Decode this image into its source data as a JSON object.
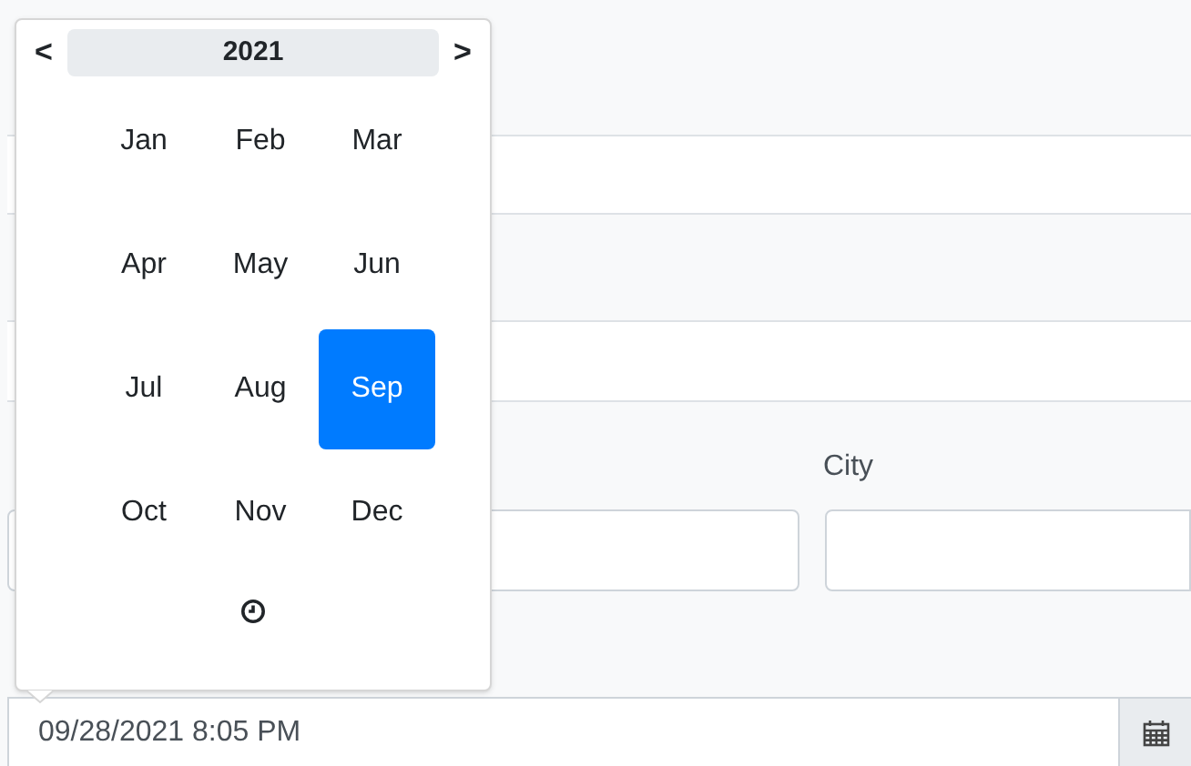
{
  "form": {
    "city_label": "City",
    "date_value": "09/28/2021 8:05 PM"
  },
  "date_picker": {
    "year": "2021",
    "prev": "<",
    "next": ">",
    "months": [
      {
        "label": "Jan",
        "selected": false
      },
      {
        "label": "Feb",
        "selected": false
      },
      {
        "label": "Mar",
        "selected": false
      },
      {
        "label": "Apr",
        "selected": false
      },
      {
        "label": "May",
        "selected": false
      },
      {
        "label": "Jun",
        "selected": false
      },
      {
        "label": "Jul",
        "selected": false
      },
      {
        "label": "Aug",
        "selected": false
      },
      {
        "label": "Sep",
        "selected": true
      },
      {
        "label": "Oct",
        "selected": false
      },
      {
        "label": "Nov",
        "selected": false
      },
      {
        "label": "Dec",
        "selected": false
      }
    ]
  }
}
